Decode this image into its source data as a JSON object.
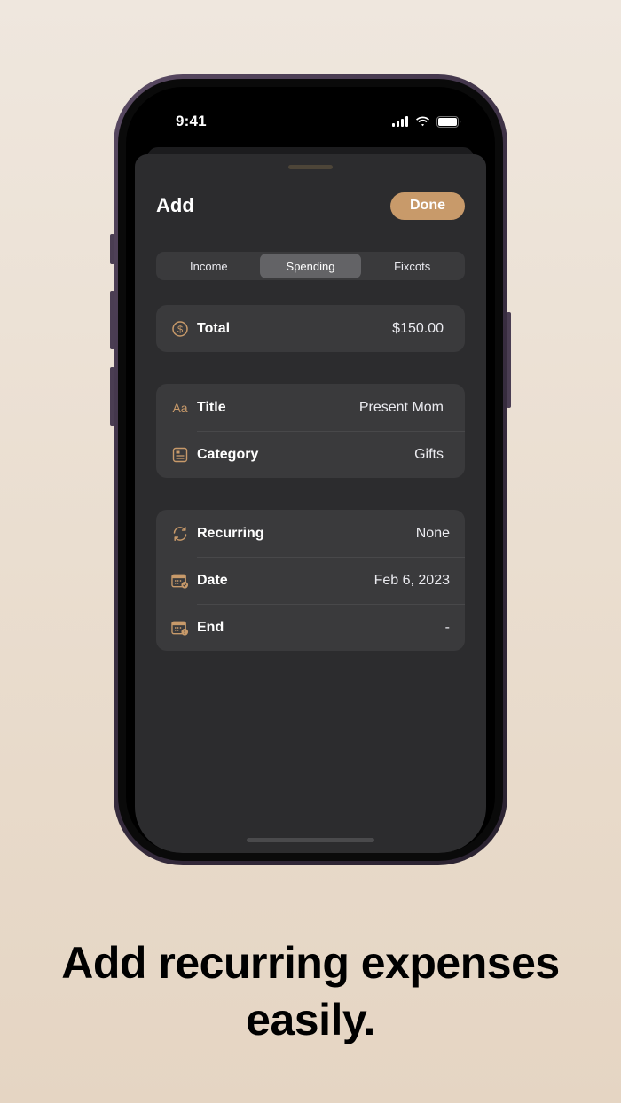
{
  "status_bar": {
    "time": "9:41"
  },
  "sheet": {
    "title": "Add",
    "done_label": "Done",
    "segments": [
      "Income",
      "Spending",
      "Fixcots"
    ],
    "active_segment": "Spending"
  },
  "amount_group": {
    "total_label": "Total",
    "total_value": "$150.00"
  },
  "details_group": {
    "title_label": "Title",
    "title_value": "Present Mom",
    "title_icon_text": "Aa",
    "category_label": "Category",
    "category_value": "Gifts"
  },
  "schedule_group": {
    "recurring_label": "Recurring",
    "recurring_value": "None",
    "date_label": "Date",
    "date_value": "Feb 6, 2023",
    "end_label": "End",
    "end_value": "-"
  },
  "tagline": {
    "line1": "Add recurring expenses",
    "line2": "easily."
  },
  "colors": {
    "accent": "#c89a6a",
    "sheet_bg": "#2c2c2e",
    "row_bg": "#3a3a3c"
  },
  "icons": [
    "dollar-circle-icon",
    "text-format-icon",
    "category-card-icon",
    "recurring-arrows-icon",
    "calendar-check-icon",
    "calendar-alert-icon"
  ]
}
